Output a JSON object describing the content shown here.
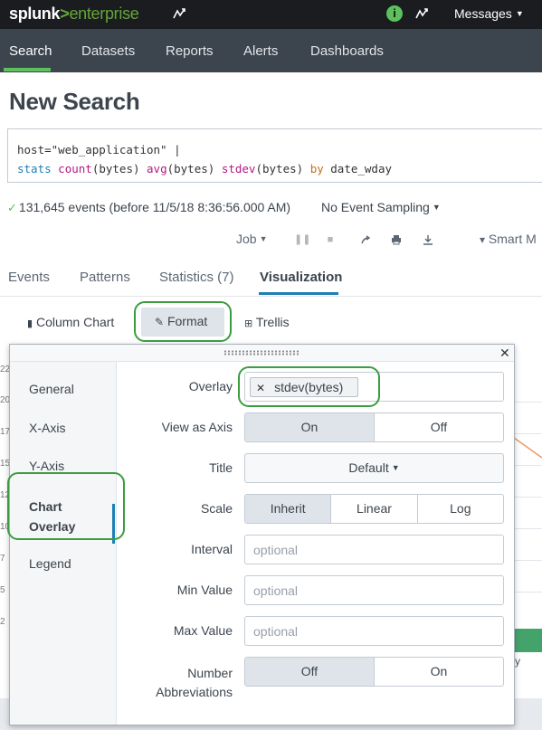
{
  "topbar": {
    "brand": "splunk",
    "gt": ">",
    "product": "enterprise",
    "info_icon_glyph": "i",
    "messages_label": "Messages"
  },
  "nav": {
    "items": [
      "Search",
      "Datasets",
      "Reports",
      "Alerts",
      "Dashboards"
    ],
    "active": "Search"
  },
  "page": {
    "title": "New Search"
  },
  "search": {
    "line1": "host=\"web_application\" |",
    "line2": {
      "cmd": "stats",
      "f1": "count",
      "a1": "(bytes)",
      "f2": "avg",
      "a2": "(bytes)",
      "f3": "stdev",
      "a3": "(bytes)",
      "by": "by",
      "field": "date_wday"
    }
  },
  "status": {
    "events_text": "131,645 events (before 11/5/18 8:36:56.000 AM)",
    "sampling": "No Event Sampling"
  },
  "jobbar": {
    "job": "Job",
    "smart": "Smart M"
  },
  "tabs": {
    "items": [
      "Events",
      "Patterns",
      "Statistics (7)",
      "Visualization"
    ],
    "active": "Visualization"
  },
  "viz_toolbar": {
    "chart_type": "Column Chart",
    "format": "Format",
    "trellis": "Trellis"
  },
  "background_chart": {
    "y_ticks": [
      "22",
      "20",
      "17",
      "15",
      "12",
      "10",
      "7",
      "5",
      "2"
    ],
    "right_fragment": "y"
  },
  "format_panel": {
    "sidebar": [
      "General",
      "X-Axis",
      "Y-Axis",
      "Chart Overlay",
      "Legend"
    ],
    "active_section": "Chart Overlay",
    "active_line1": "Chart",
    "active_line2": "Overlay",
    "fields": {
      "overlay_label": "Overlay",
      "overlay_chip": "stdev(bytes)",
      "view_as_axis_label": "View as Axis",
      "view_as_axis_options": [
        "On",
        "Off"
      ],
      "view_as_axis_selected": "On",
      "title_label": "Title",
      "title_value": "Default",
      "scale_label": "Scale",
      "scale_options": [
        "Inherit",
        "Linear",
        "Log"
      ],
      "scale_selected": "Inherit",
      "interval_label": "Interval",
      "interval_placeholder": "optional",
      "min_label": "Min Value",
      "min_placeholder": "optional",
      "max_label": "Max Value",
      "max_placeholder": "optional",
      "abbrev_label_line1": "Number",
      "abbrev_label_line2": "Abbreviations",
      "abbrev_options": [
        "Off",
        "On"
      ],
      "abbrev_selected": "Off"
    }
  },
  "colors": {
    "topbar": "#1a1c20",
    "navbar": "#3c444d",
    "accent_green": "#5cc05c",
    "highlight_green": "#3a9d3e",
    "link_blue": "#1d7fb5"
  }
}
